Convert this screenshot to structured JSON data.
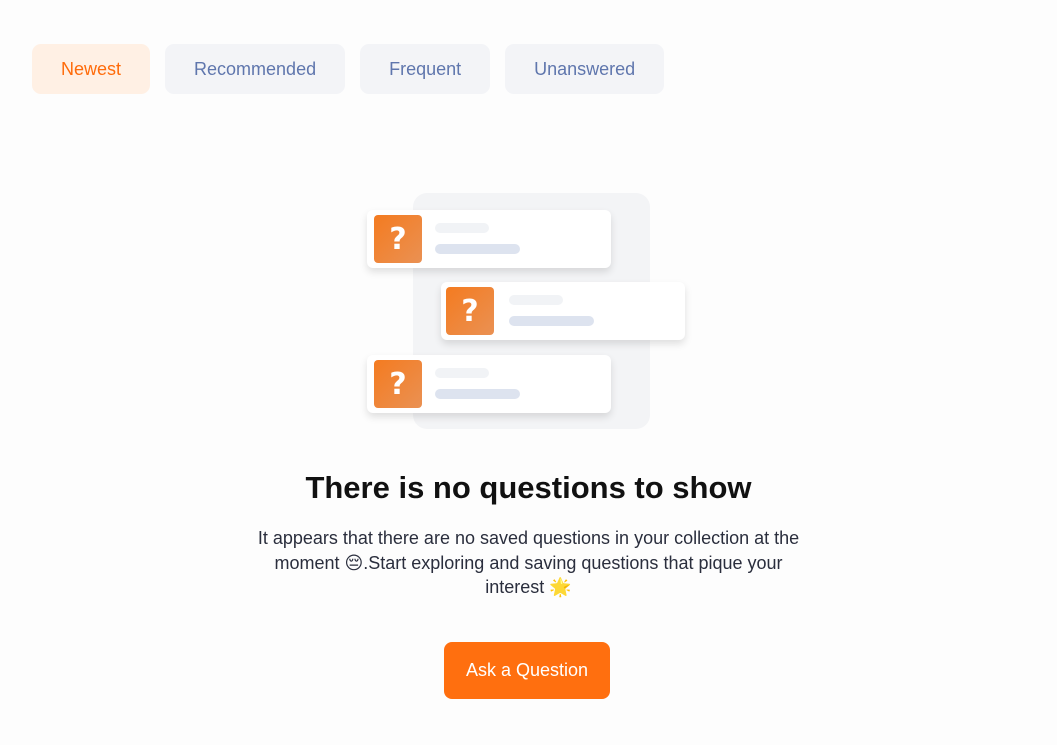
{
  "filters": {
    "tabs": [
      {
        "label": "Newest",
        "active": true
      },
      {
        "label": "Recommended",
        "active": false
      },
      {
        "label": "Frequent",
        "active": false
      },
      {
        "label": "Unanswered",
        "active": false
      }
    ]
  },
  "illustration": {
    "cards": [
      {
        "icon": "question-mark-icon",
        "glyph": "?"
      },
      {
        "icon": "question-mark-icon",
        "glyph": "?"
      },
      {
        "icon": "question-mark-icon",
        "glyph": "?"
      }
    ]
  },
  "empty_state": {
    "title": "There is no questions to show",
    "description": "It appears that there are no saved questions in your collection at the moment 😔.Start exploring and saving questions that pique your interest 🌟",
    "cta_label": "Ask a Question"
  },
  "colors": {
    "accent": "#ff6f0f",
    "active_tab_bg": "#fff0e4",
    "tab_bg": "#f3f4f7",
    "tab_text": "#5f76ad"
  }
}
